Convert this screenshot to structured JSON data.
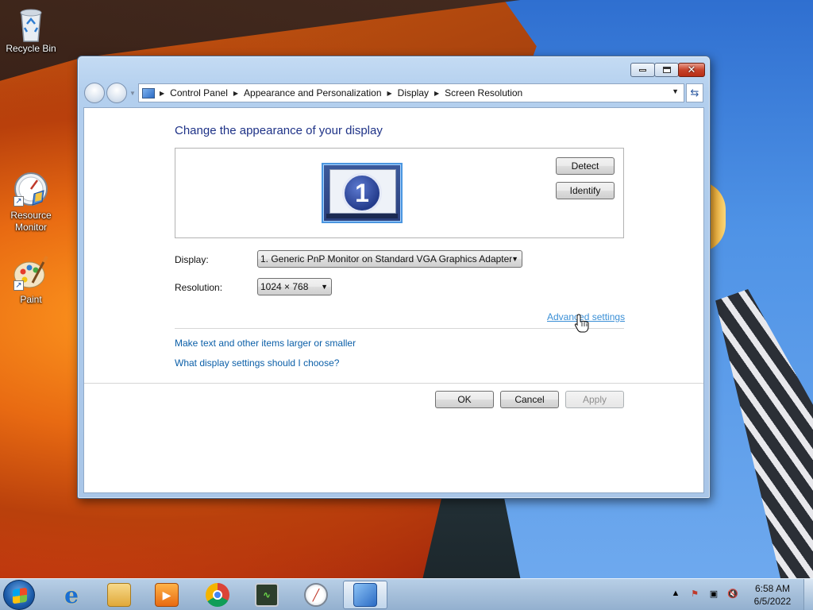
{
  "desktop": {
    "icons": [
      {
        "label": "Recycle Bin"
      },
      {
        "label": "Resource Monitor"
      },
      {
        "label": "Paint"
      }
    ]
  },
  "window": {
    "breadcrumbs": [
      "Control Panel",
      "Appearance and Personalization",
      "Display",
      "Screen Resolution"
    ],
    "heading": "Change the appearance of your display",
    "monitor_number": "1",
    "detect_label": "Detect",
    "identify_label": "Identify",
    "display_label": "Display:",
    "display_value": "1. Generic PnP Monitor on Standard VGA Graphics Adapter",
    "resolution_label": "Resolution:",
    "resolution_value": "1024 × 768",
    "advanced_link": "Advanced settings",
    "link_text_size": "Make text and other items larger or smaller",
    "link_display_help": "What display settings should I choose?",
    "ok_label": "OK",
    "cancel_label": "Cancel",
    "apply_label": "Apply"
  },
  "taskbar": {
    "pinned": [
      {
        "name": "internet-explorer"
      },
      {
        "name": "windows-explorer"
      },
      {
        "name": "media-player"
      },
      {
        "name": "google-chrome"
      },
      {
        "name": "performance-monitor"
      },
      {
        "name": "resource-monitor"
      },
      {
        "name": "control-panel"
      }
    ],
    "time": "6:58 AM",
    "date": "6/5/2022"
  },
  "colors": {
    "heading": "#1e3287",
    "link": "#0b5fa8",
    "accent": "#3a8fd6"
  }
}
